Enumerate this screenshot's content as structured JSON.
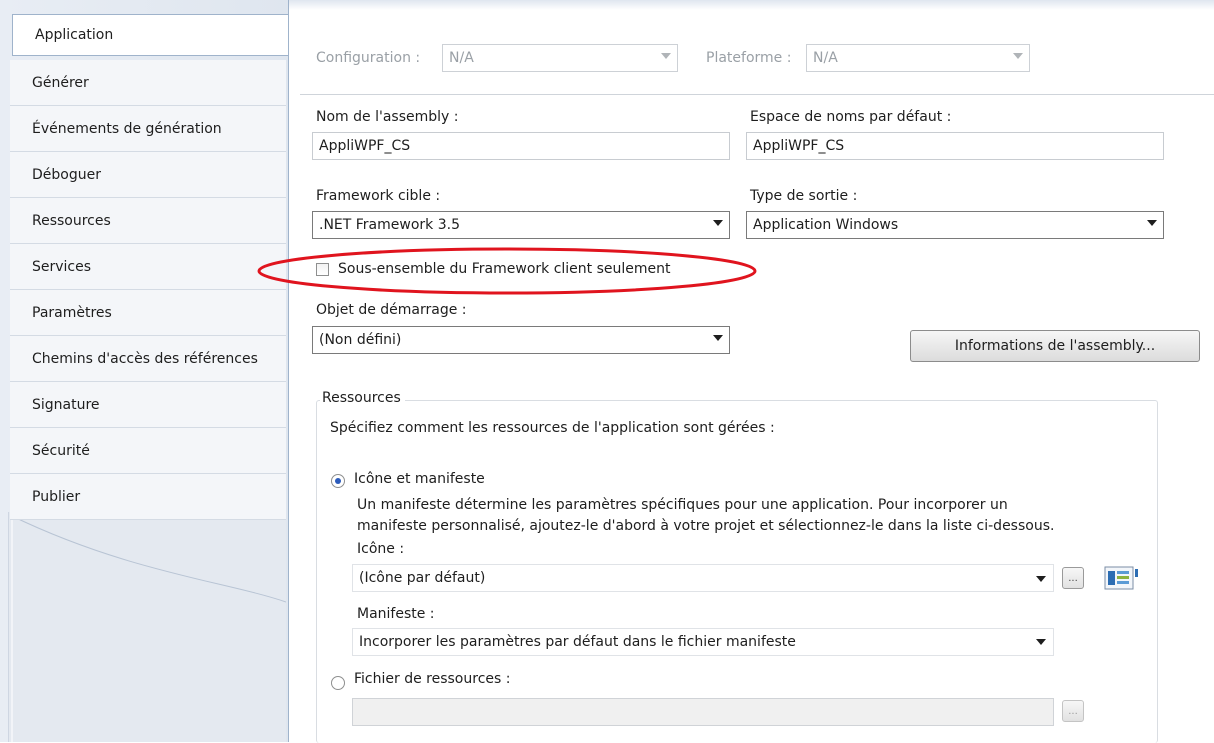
{
  "sidebar": {
    "items": [
      {
        "label": "Application"
      },
      {
        "label": "Générer"
      },
      {
        "label": "Événements de génération"
      },
      {
        "label": "Déboguer"
      },
      {
        "label": "Ressources"
      },
      {
        "label": "Services"
      },
      {
        "label": "Paramètres"
      },
      {
        "label": "Chemins d'accès des références"
      },
      {
        "label": "Signature"
      },
      {
        "label": "Sécurité"
      },
      {
        "label": "Publier"
      }
    ],
    "active_index": 0
  },
  "toolbar": {
    "configuration_label": "Configuration :",
    "configuration_value": "N/A",
    "platform_label": "Plateforme :",
    "platform_value": "N/A"
  },
  "form": {
    "assembly_name_label": "Nom de l'assembly :",
    "assembly_name_value": "AppliWPF_CS",
    "namespace_label": "Espace de noms par défaut :",
    "namespace_value": "AppliWPF_CS",
    "target_framework_label": "Framework cible :",
    "target_framework_value": ".NET Framework 3.5",
    "output_type_label": "Type de sortie :",
    "output_type_value": "Application Windows",
    "client_profile_label": "Sous-ensemble du Framework client seulement",
    "client_profile_checked": false,
    "startup_object_label": "Objet de démarrage :",
    "startup_object_value": "(Non défini)",
    "assembly_info_button": "Informations de l'assembly..."
  },
  "resources": {
    "group_title": "Ressources",
    "description": "Spécifiez comment les ressources de l'application sont gérées :",
    "icon_manifest_option": "Icône et manifeste",
    "icon_manifest_selected": true,
    "manifest_help_line1": "Un manifeste détermine les paramètres spécifiques pour une application. Pour incorporer un",
    "manifest_help_line2": "manifeste personnalisé, ajoutez-le d'abord à votre projet et sélectionnez-le dans la liste ci-dessous.",
    "icon_label": "Icône :",
    "icon_value": "(Icône par défaut)",
    "browse_label": "...",
    "manifest_label": "Manifeste :",
    "manifest_value": "Incorporer les paramètres par défaut dans le fichier manifeste",
    "resource_file_option": "Fichier de ressources :",
    "resource_file_selected": false,
    "resource_file_value": ""
  },
  "colors": {
    "highlight_ellipse": "#e0141e",
    "radio_selected": "#2c5bbb"
  }
}
